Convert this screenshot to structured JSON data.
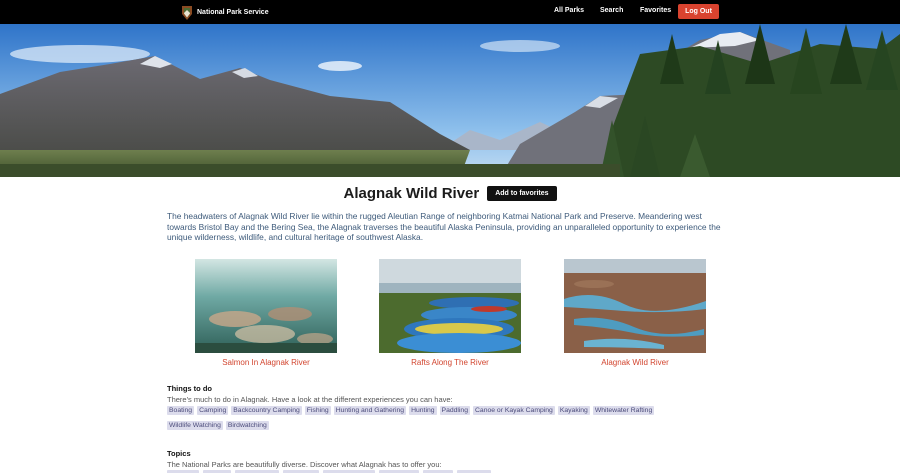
{
  "nav": {
    "brand": "National Park Service",
    "links": [
      "All Parks",
      "Search",
      "Favorites"
    ],
    "logout": "Log Out"
  },
  "park": {
    "name": "Alagnak Wild River",
    "favorite_label": "Add to favorites",
    "description": "The headwaters of Alagnak Wild River lie within the rugged Aleutian Range of neighboring Katmai National Park and Preserve. Meandering west towards Bristol Bay and the Bering Sea, the Alagnak traverses the beautiful Alaska Peninsula, providing an unparalleled opportunity to experience the unique wilderness, wildlife, and cultural heritage of southwest Alaska."
  },
  "gallery": [
    {
      "caption": "Salmon In Alagnak River"
    },
    {
      "caption": "Rafts Along The River"
    },
    {
      "caption": "Alagnak Wild River"
    }
  ],
  "things_to_do": {
    "title": "Things to do",
    "subtitle": "There's much to do in Alagnak. Have a look at the different experiences you can have:",
    "tags": [
      "Boating",
      "Camping",
      "Backcountry Camping",
      "Fishing",
      "Hunting and Gathering",
      "Hunting",
      "Paddling",
      "Canoe or Kayak Camping",
      "Kayaking",
      "Whitewater Rafting",
      "Wildlife Watching",
      "Birdwatching"
    ]
  },
  "topics": {
    "title": "Topics",
    "subtitle": "The National Parks are beautifully diverse. Discover what Alagnak has to offer you:"
  },
  "colors": {
    "nav_bg": "#000000",
    "accent": "#d9432f",
    "caption": "#d2452f",
    "tag_bg": "#dcdcec",
    "description_text": "#3d5a7a"
  }
}
